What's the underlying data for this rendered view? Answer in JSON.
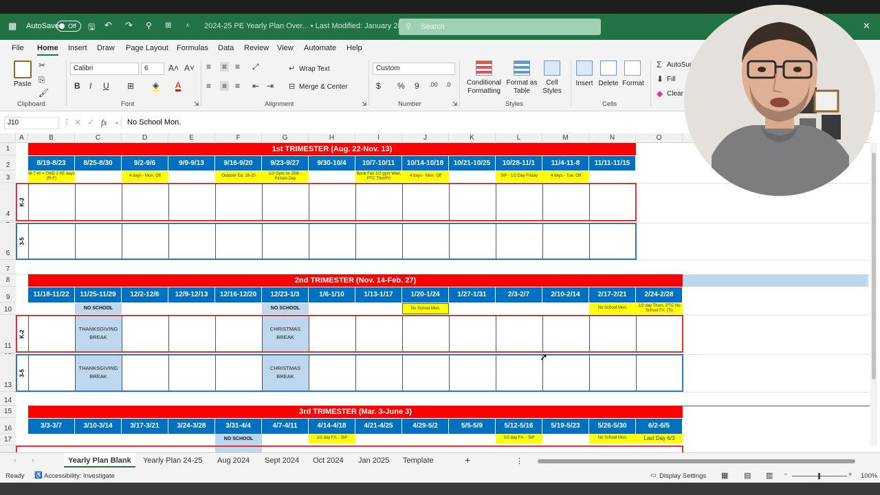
{
  "titlebar": {
    "autosave_label": "AutoSave",
    "autosave_state": "Off",
    "file_title": "2024-25 PE Yearly Plan Over... • Last Modified: January 28",
    "search_placeholder": "Search"
  },
  "menu": [
    "File",
    "Home",
    "Insert",
    "Draw",
    "Page Layout",
    "Formulas",
    "Data",
    "Review",
    "View",
    "Automate",
    "Help"
  ],
  "ribbon": {
    "paste": "Paste",
    "clipboard": "Clipboard",
    "font_name": "Calibri",
    "font_size": "6",
    "font": "Font",
    "wrap_text": "Wrap Text",
    "merge_center": "Merge & Center",
    "alignment": "Alignment",
    "number_format": "Custom",
    "number": "Number",
    "conditional_formatting": "Conditional Formatting",
    "format_as_table": "Format as Table",
    "cell_styles": "Cell Styles",
    "styles": "Styles",
    "insert": "Insert",
    "delete": "Delete",
    "format": "Format",
    "cells": "Cells",
    "autosum": "AutoSum",
    "fill": "Fill",
    "clear": "Clear"
  },
  "formula_bar": {
    "name_box": "J10",
    "fx": "fx",
    "content": "No School Mon."
  },
  "columns": [
    "A",
    "B",
    "C",
    "D",
    "E",
    "F",
    "G",
    "H",
    "I",
    "J",
    "K",
    "L",
    "M",
    "N",
    "O"
  ],
  "rows": [
    "1",
    "2",
    "3",
    "4",
    "5",
    "6",
    "7",
    "8",
    "9",
    "10",
    "11",
    "12",
    "13",
    "14",
    "15",
    "16",
    "17"
  ],
  "sheet": {
    "t1_title": "1st TRIMESTER (Aug. 22-Nov. 13)",
    "t1_weeks": [
      "8/19-8/23",
      "8/25-8/30",
      "9/2-9/6",
      "9/9-9/13",
      "9/16-9/20",
      "9/23-9/27",
      "9/30-10/4",
      "10/7-10/11",
      "10/14-10/18",
      "10/21-10/25",
      "10/28-11/1",
      "11/4-11-8",
      "11/11-11/15"
    ],
    "t1_notes": {
      "b": "M-T-W = TWD 2 PE days (R-F)",
      "d": "4 days - Mon. Off",
      "f": "Outdoor Ed. 18-20",
      "g": "1/2 Gym on 25th - Picture Day",
      "i": "Book Fair 1/2 gym Wed, PTC Thur/Fri",
      "j": "4 days - Mon. Off",
      "l": "SIP - 1/2 Day Friday",
      "m": "4 days - Tue. Off"
    },
    "grade_k2": "K-2",
    "grade_35": "3-5",
    "t2_title": "2nd TRIMESTER (Nov. 14-Feb. 27)",
    "t2_weeks": [
      "11/18-11/22",
      "11/25-11/29",
      "12/2-12/6",
      "12/9-12/13",
      "12/16-12/20",
      "12/23-1/3",
      "1/6-1/10",
      "1/13-1/17",
      "1/20-1/24",
      "1/27-1/31",
      "2/3-2/7",
      "2/10-2/14",
      "2/17-2/21",
      "2/24-2/28"
    ],
    "t2_notes": {
      "c": "NO SCHOOL",
      "g": "NO SCHOOL",
      "j": "No School Mon.",
      "n": "No School Mon.",
      "o": "1/2 day Thurs. PTC No School Fri. (TI)"
    },
    "thanksgiving": "THANKSGIVING BREAK",
    "christmas": "CHRISTMAS BREAK",
    "t3_title": "3rd TRIMESTER (Mar. 3-June 3)",
    "t3_weeks": [
      "3/3-3/7",
      "3/10-3/14",
      "3/17-3/21",
      "3/24-3/28",
      "3/31-4/4",
      "4/7-4/11",
      "4/14-4/18",
      "4/21-4/25",
      "4/29-5/2",
      "5/5-5/9",
      "5/12-5/16",
      "5/19-5/23",
      "5/26-5/30",
      "6/2-6/5"
    ],
    "t3_notes": {
      "f": "NO SCHOOL",
      "h": "1/2 day Fri. - SIP",
      "l": "1/2 day Fri. - SIP",
      "n": "No School Mon.",
      "o": "Last Day 6/3"
    }
  },
  "tabs": [
    "Yearly Plan Blank",
    "Yearly Plan 24-25",
    "Aug 2024",
    "Sept 2024",
    "Oct 2024",
    "Jan 2025",
    "Template"
  ],
  "status": {
    "ready": "Ready",
    "accessibility": "Accessibility: Investigate",
    "display_settings": "Display Settings",
    "zoom": "100%"
  },
  "colors": {
    "excel_green": "#217346",
    "banner_red": "#ff0000",
    "week_blue": "#0070c0",
    "note_yellow": "#ffff00",
    "break_blue": "#bdd7ee"
  }
}
